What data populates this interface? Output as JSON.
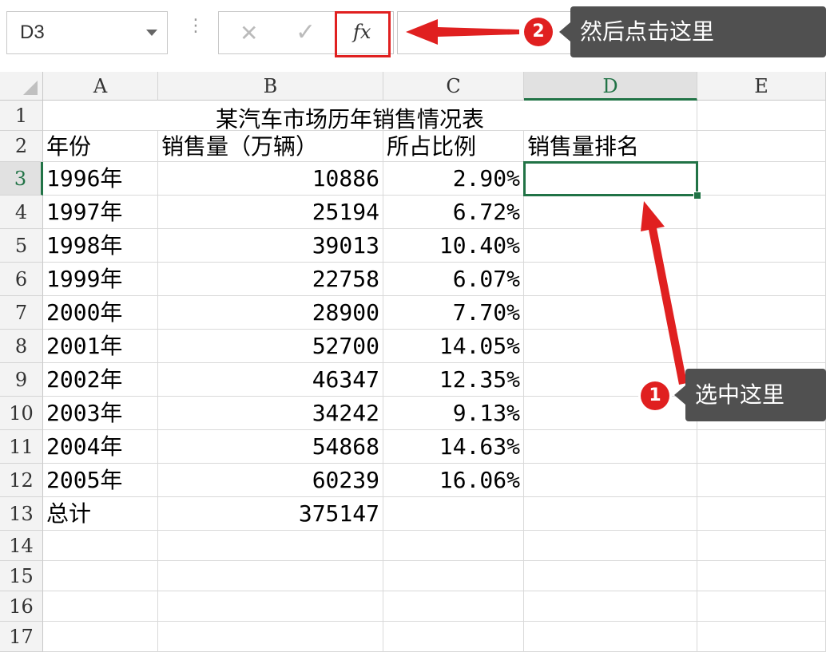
{
  "formula_bar": {
    "name_box": "D3",
    "cancel_glyph": "✕",
    "enter_glyph": "✓",
    "fx_label": "fx",
    "formula_value": ""
  },
  "columns": [
    "A",
    "B",
    "C",
    "D",
    "E"
  ],
  "selected_column": "D",
  "rows": [
    "1",
    "2",
    "3",
    "4",
    "5",
    "6",
    "7",
    "8",
    "9",
    "10",
    "11",
    "12",
    "13",
    "14",
    "15",
    "16",
    "17"
  ],
  "selected_row": "3",
  "sheet": {
    "title": "某汽车市场历年销售情况表",
    "headers": {
      "year": "年份",
      "sales": "销售量（万辆）",
      "share": "所占比例",
      "rank": "销售量排名"
    },
    "data": [
      {
        "year": "1996年",
        "sales": "10886",
        "share": "2.90%"
      },
      {
        "year": "1997年",
        "sales": "25194",
        "share": "6.72%"
      },
      {
        "year": "1998年",
        "sales": "39013",
        "share": "10.40%"
      },
      {
        "year": "1999年",
        "sales": "22758",
        "share": "6.07%"
      },
      {
        "year": "2000年",
        "sales": "28900",
        "share": "7.70%"
      },
      {
        "year": "2001年",
        "sales": "52700",
        "share": "14.05%"
      },
      {
        "year": "2002年",
        "sales": "46347",
        "share": "12.35%"
      },
      {
        "year": "2003年",
        "sales": "34242",
        "share": "9.13%"
      },
      {
        "year": "2004年",
        "sales": "54868",
        "share": "14.63%"
      },
      {
        "year": "2005年",
        "sales": "60239",
        "share": "16.06%"
      }
    ],
    "total": {
      "label": "总计",
      "value": "375147"
    }
  },
  "annotations": {
    "step1": {
      "number": "1",
      "text": "选中这里"
    },
    "step2": {
      "number": "2",
      "text": "然后点击这里"
    },
    "highlight_color": "#e02020",
    "selection_color": "#217346"
  }
}
